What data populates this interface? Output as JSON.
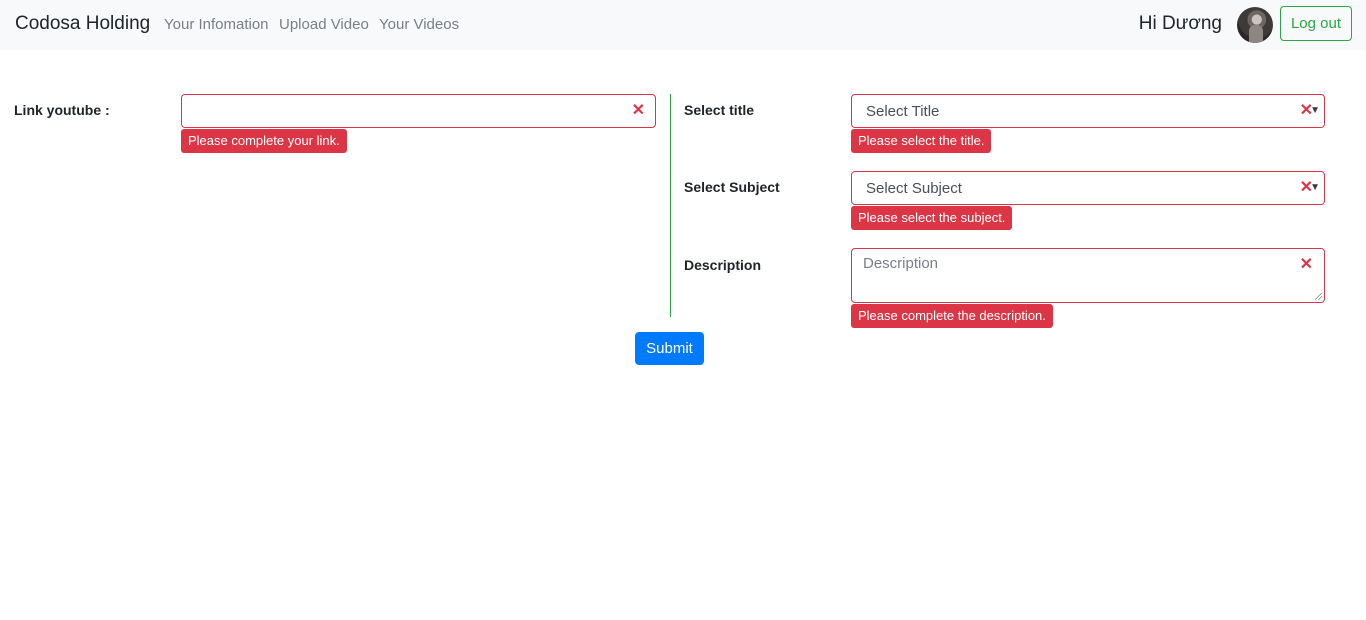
{
  "navbar": {
    "brand": "Codosa Holding",
    "links": [
      "Your Infomation",
      "Upload Video",
      "Your Videos"
    ],
    "greeting": "Hi Dương",
    "logout_label": "Log out"
  },
  "form": {
    "link": {
      "label": "Link youtube :",
      "value": "",
      "error": "Please complete your link."
    },
    "title": {
      "label": "Select title",
      "selected": "Select Title",
      "error": "Please select the title."
    },
    "subject": {
      "label": "Select Subject",
      "selected": "Select Subject",
      "error": "Please select the subject."
    },
    "description": {
      "label": "Description",
      "placeholder": "Description",
      "error": "Please complete the description."
    },
    "submit_label": "Submit"
  },
  "icons": {
    "clear": "close-icon",
    "dropdown": "caret-down-icon",
    "resize": "resize-handle-icon"
  },
  "colors": {
    "error": "#dc3545",
    "accent": "#007bff",
    "success": "#28a745",
    "navbar_bg": "#f8f9fa"
  }
}
